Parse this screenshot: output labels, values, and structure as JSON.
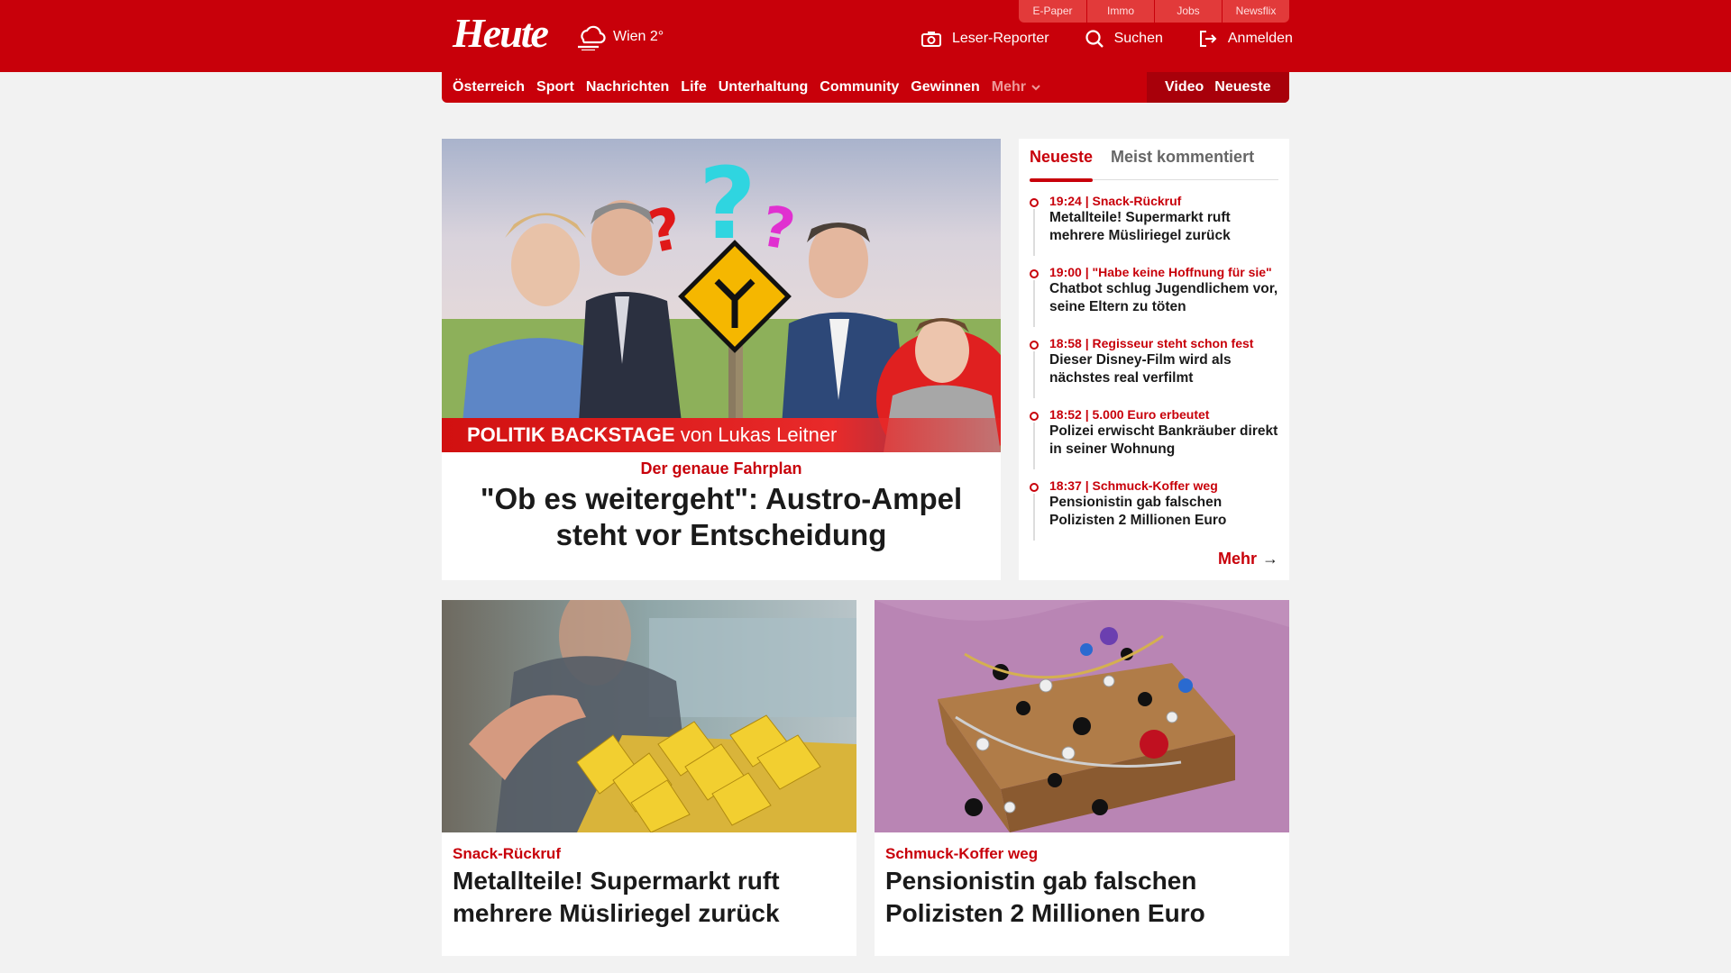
{
  "header": {
    "logo": "Heute",
    "weather": "Wien 2°",
    "top_links": [
      "E-Paper",
      "Immo",
      "Jobs",
      "Newsflix"
    ],
    "actions": {
      "reporter": "Leser-Reporter",
      "search": "Suchen",
      "login": "Anmelden"
    }
  },
  "nav": {
    "items": [
      "Österreich",
      "Sport",
      "Nachrichten",
      "Life",
      "Unterhaltung",
      "Community",
      "Gewinnen"
    ],
    "more": "Mehr",
    "right": [
      "Video",
      "Neueste"
    ]
  },
  "hero": {
    "caption_bold": "POLITIK BACKSTAGE",
    "caption_rest": "von Lukas Leitner",
    "kicker": "Der genaue Fahrplan",
    "title": "\"Ob es weitergeht\": Austro-Ampel steht vor Entscheidung"
  },
  "sidebar": {
    "tabs": [
      "Neueste",
      "Meist kommentiert"
    ],
    "items": [
      {
        "meta": "19:24 | Snack-Rückruf",
        "title": "Metallteile! Supermarkt ruft mehrere Müsliriegel zurück"
      },
      {
        "meta": "19:00 | \"Habe keine Hoffnung für sie\"",
        "title": "Chatbot schlug Jugendlichem vor, seine Eltern zu töten"
      },
      {
        "meta": "18:58 | Regisseur steht schon fest",
        "title": "Dieser Disney-Film wird als nächstes real verfilmt"
      },
      {
        "meta": "18:52 | 5.000 Euro erbeutet",
        "title": "Polizei erwischt Bankräuber direkt in seiner Wohnung"
      },
      {
        "meta": "18:37 | Schmuck-Koffer weg",
        "title": "Pensionistin gab falschen Polizisten 2 Millionen Euro"
      }
    ],
    "more": "Mehr"
  },
  "cards": [
    {
      "kicker": "Snack-Rückruf",
      "title": "Metallteile! Supermarkt ruft mehrere Müsliriegel zurück"
    },
    {
      "kicker": "Schmuck-Koffer weg",
      "title": "Pensionistin gab falschen Polizisten 2 Millionen Euro"
    }
  ],
  "colors": {
    "brand": "#c8000a",
    "background": "#f2f2f2"
  }
}
